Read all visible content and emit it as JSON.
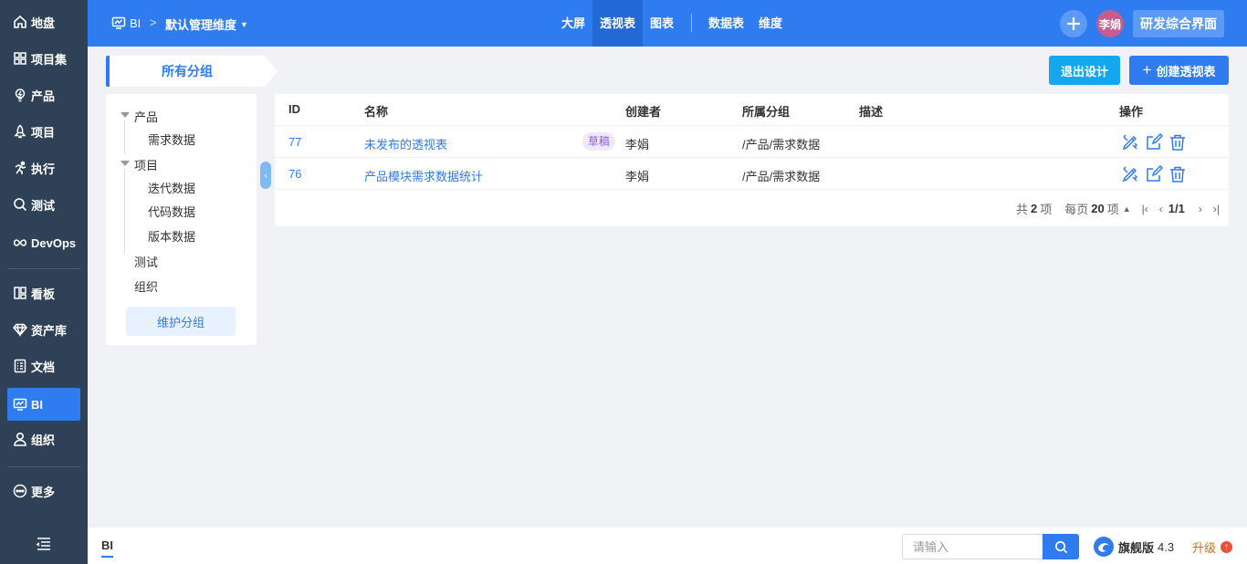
{
  "sidebar": {
    "items": [
      {
        "label": "地盘",
        "icon": "home-icon"
      },
      {
        "label": "项目集",
        "icon": "grid-icon"
      },
      {
        "label": "产品",
        "icon": "lightbulb-icon"
      },
      {
        "label": "项目",
        "icon": "rocket-icon"
      },
      {
        "label": "执行",
        "icon": "runner-icon"
      },
      {
        "label": "测试",
        "icon": "search-bug-icon"
      },
      {
        "label": "DevOps",
        "icon": "infinity-icon"
      },
      {
        "label": "看板",
        "icon": "kanban-icon"
      },
      {
        "label": "资产库",
        "icon": "diamond-icon"
      },
      {
        "label": "文档",
        "icon": "document-icon"
      },
      {
        "label": "BI",
        "icon": "monitor-chart-icon",
        "active": true
      },
      {
        "label": "组织",
        "icon": "user-icon"
      },
      {
        "label": "更多",
        "icon": "more-dots-icon"
      }
    ]
  },
  "header": {
    "module": "BI",
    "separator": ">",
    "dimension": "默认管理维度",
    "nav": [
      {
        "label": "大屏"
      },
      {
        "label": "透视表",
        "active": true
      },
      {
        "label": "图表"
      },
      {
        "label": "数据表"
      },
      {
        "label": "维度"
      }
    ],
    "avatar": "李娟",
    "app_switch": "研发综合界面"
  },
  "group_tab": {
    "label": "所有分组"
  },
  "actions": {
    "exit_design": "退出设计",
    "create_pivot": "创建透视表"
  },
  "tree": {
    "nodes": [
      {
        "label": "产品",
        "level": 0,
        "expanded": true
      },
      {
        "label": "需求数据",
        "level": 1
      },
      {
        "label": "项目",
        "level": 0,
        "expanded": true
      },
      {
        "label": "迭代数据",
        "level": 1
      },
      {
        "label": "代码数据",
        "level": 1
      },
      {
        "label": "版本数据",
        "level": 1
      },
      {
        "label": "测试",
        "level": 0
      },
      {
        "label": "组织",
        "level": 0
      }
    ],
    "maintain_label": "维护分组"
  },
  "table": {
    "columns": [
      "ID",
      "名称",
      "创建者",
      "所属分组",
      "描述",
      "操作"
    ],
    "rows": [
      {
        "id": "77",
        "name": "未发布的透视表",
        "badge": "草稿",
        "creator": "李娟",
        "group": "/产品/需求数据",
        "desc": ""
      },
      {
        "id": "76",
        "name": "产品模块需求数据统计",
        "badge": "",
        "creator": "李娟",
        "group": "/产品/需求数据",
        "desc": ""
      }
    ]
  },
  "pager": {
    "total_prefix": "共",
    "total": "2",
    "total_suffix": "项",
    "per_prefix": "每页",
    "per_page": "20",
    "per_suffix": "项",
    "page": "1/1"
  },
  "bottom": {
    "tab": "BI",
    "search_placeholder": "请输入",
    "edition_name": "旗舰版",
    "edition_version": "4.3",
    "upgrade": "升级"
  },
  "colors": {
    "primary": "#2f7bf0",
    "sidebar_bg": "#2f4156",
    "draft_badge": "#8e5cd9"
  }
}
